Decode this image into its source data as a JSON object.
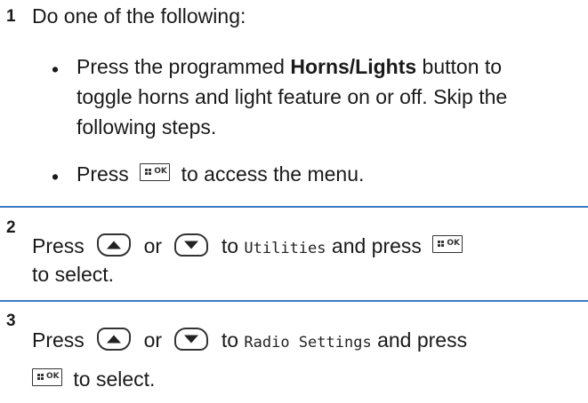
{
  "steps": [
    {
      "number": "1",
      "intro": "Do one of the following:",
      "bullets": [
        {
          "mark": "•",
          "line1_pre": "Press the programmed ",
          "line1_bold": "Horns/Lights",
          "line1_post": " button to",
          "line2": "toggle horns and light feature on or off. Skip the",
          "line3": "following steps."
        },
        {
          "mark": "•",
          "pre": "Press",
          "key_icon": "menu-ok-key-icon",
          "post": "to access the menu."
        }
      ]
    },
    {
      "number": "2",
      "pre": "Press",
      "up_icon": "up-arrow-key-icon",
      "or": "or",
      "down_icon": "down-arrow-key-icon",
      "to": "to",
      "menu_item": "Utilities",
      "and_press": "and press",
      "key_icon": "menu-ok-key-icon",
      "line2": "to select."
    },
    {
      "number": "3",
      "pre": "Press",
      "up_icon": "up-arrow-key-icon",
      "or": "or",
      "down_icon": "down-arrow-key-icon",
      "to": "to",
      "menu_item": "Radio Settings",
      "and_press": "and press",
      "key_icon": "menu-ok-key-icon",
      "line2": "to select."
    }
  ],
  "ok_key_label": "OK",
  "colors": {
    "divider": "#3c7ac0",
    "text": "#1a1a1a"
  }
}
